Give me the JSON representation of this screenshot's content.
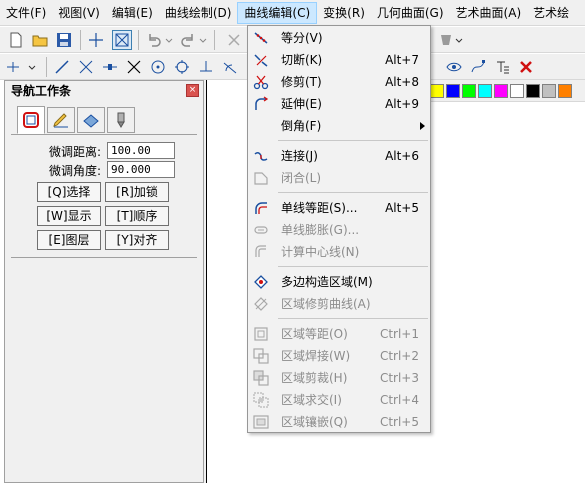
{
  "menubar": {
    "items": [
      {
        "label": "文件(F)"
      },
      {
        "label": "视图(V)"
      },
      {
        "label": "编辑(E)"
      },
      {
        "label": "曲线绘制(D)"
      },
      {
        "label": "曲线编辑(C)"
      },
      {
        "label": "变换(R)"
      },
      {
        "label": "几何曲面(G)"
      },
      {
        "label": "艺术曲面(A)"
      },
      {
        "label": "艺术绘"
      }
    ]
  },
  "navigator": {
    "title": "导航工作条",
    "close_glyph": "×",
    "fine_distance_label": "微调距离:",
    "fine_distance_value": "100.00",
    "fine_angle_label": "微调角度:",
    "fine_angle_value": "90.000",
    "buttons": [
      {
        "label": "[Q]选择"
      },
      {
        "label": "[R]加锁"
      },
      {
        "label": "[W]显示"
      },
      {
        "label": "[T]顺序"
      },
      {
        "label": "[E]图层"
      },
      {
        "label": "[Y]对齐"
      }
    ]
  },
  "dropdown": {
    "items": [
      {
        "label": "等分(V)",
        "shortcut": "",
        "icon": "equal-divide-icon",
        "disabled": false
      },
      {
        "label": "切断(K)",
        "shortcut": "Alt+7",
        "icon": "cut-off-icon",
        "disabled": false
      },
      {
        "label": "修剪(T)",
        "shortcut": "Alt+8",
        "icon": "scissors-icon",
        "disabled": false
      },
      {
        "label": "延伸(E)",
        "shortcut": "Alt+9",
        "icon": "extend-icon",
        "disabled": false
      },
      {
        "label": "倒角(F)",
        "shortcut": "",
        "icon": "",
        "disabled": false,
        "submenu": true
      },
      {
        "label": "连接(J)",
        "shortcut": "Alt+6",
        "icon": "join-icon",
        "disabled": false
      },
      {
        "label": "闭合(L)",
        "shortcut": "",
        "icon": "close-shape-icon",
        "disabled": true
      },
      {
        "label": "单线等距(S)...",
        "shortcut": "Alt+5",
        "icon": "offset-icon",
        "disabled": false
      },
      {
        "label": "单线膨胀(G)...",
        "shortcut": "",
        "icon": "expand-icon",
        "disabled": true
      },
      {
        "label": "计算中心线(N)",
        "shortcut": "",
        "icon": "centerline-icon",
        "disabled": true
      },
      {
        "label": "多边构造区域(M)",
        "shortcut": "",
        "icon": "polygon-region-icon",
        "disabled": false
      },
      {
        "label": "区域修剪曲线(A)",
        "shortcut": "",
        "icon": "region-trim-icon",
        "disabled": true
      },
      {
        "label": "区域等距(O)",
        "shortcut": "Ctrl+1",
        "icon": "region-offset-icon",
        "disabled": true
      },
      {
        "label": "区域焊接(W)",
        "shortcut": "Ctrl+2",
        "icon": "region-weld-icon",
        "disabled": true
      },
      {
        "label": "区域剪裁(H)",
        "shortcut": "Ctrl+3",
        "icon": "region-clip-icon",
        "disabled": true
      },
      {
        "label": "区域求交(I)",
        "shortcut": "Ctrl+4",
        "icon": "region-intersect-icon",
        "disabled": true
      },
      {
        "label": "区域镶嵌(Q)",
        "shortcut": "Ctrl+5",
        "icon": "region-inlay-icon",
        "disabled": true
      }
    ]
  },
  "palette": {
    "colors": [
      "#ffff00",
      "#0000ff",
      "#00ff00",
      "#00ffff",
      "#ff00ff",
      "#ffffff",
      "#000000",
      "#c0c0c0",
      "#ff8000"
    ]
  },
  "colors": {
    "menu_highlight": "#cce8ff",
    "disabled_text": "#8c8c8c"
  }
}
